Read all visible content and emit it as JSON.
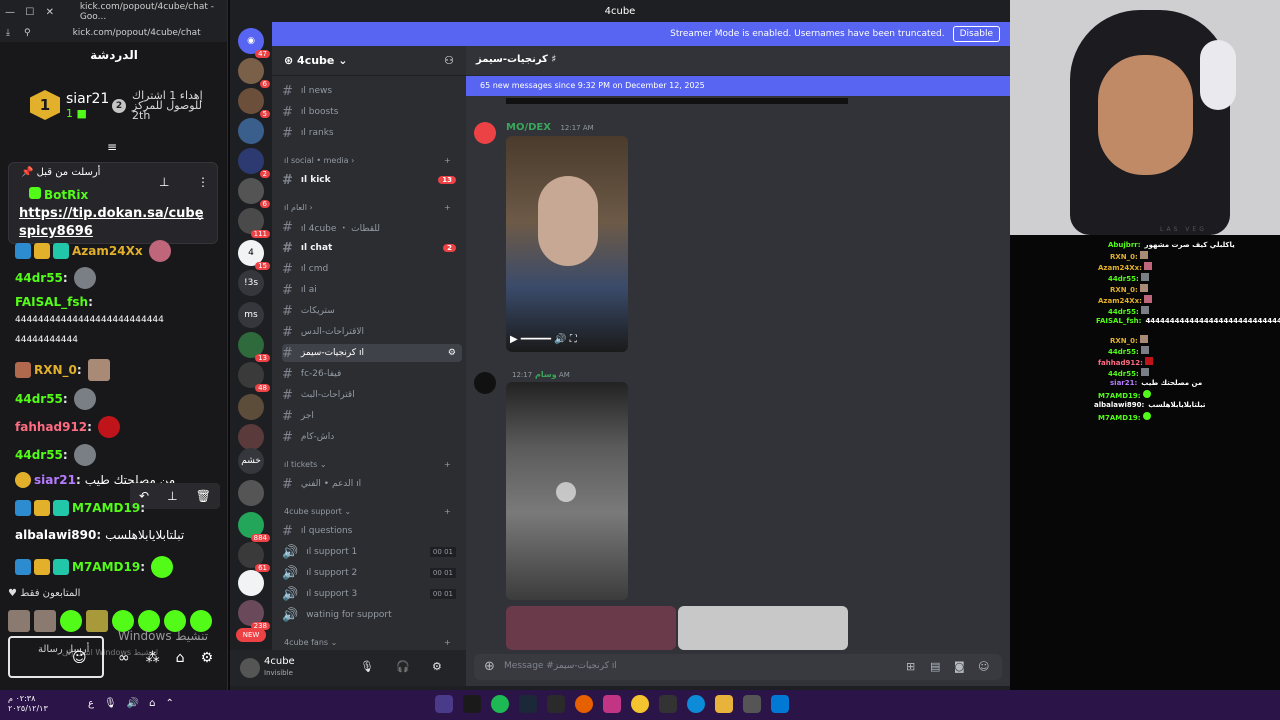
{
  "kick": {
    "window_title": "kick.com/popout/4cube/chat - Goo...",
    "url": "kick.com/popout/4cube/chat",
    "panel_title": "الدردشة",
    "leader": {
      "rank": "1",
      "name": "siar21",
      "count": "1"
    },
    "leader2": {
      "rank": "2",
      "text": "إهداء 1 اشتراك للوصول للمركز 2th"
    },
    "pinned": {
      "header": "أرسلت من قبل",
      "sender": "BotRix",
      "link": "https://tip.dokan.sa/cube spicy8696"
    },
    "messages": [
      {
        "user": "Azam24Xx",
        "text": "",
        "color": "#e2b02b"
      },
      {
        "user": "44dr55",
        "text": "",
        "color": "#53fc18"
      },
      {
        "user": "FAISAL_fsh",
        "text": "",
        "color": "#53fc18"
      },
      {
        "user": "",
        "text": "44444444444444444444444444",
        "color": "#ffffff"
      },
      {
        "user": "",
        "text": "44444444444",
        "color": "#ffffff"
      },
      {
        "user": "RXN_0",
        "text": "",
        "color": "#e2b02b"
      },
      {
        "user": "44dr55",
        "text": "",
        "color": "#53fc18"
      },
      {
        "user": "fahhad912",
        "text": "",
        "color": "#ff6b81"
      },
      {
        "user": "44dr55",
        "text": "",
        "color": "#53fc18"
      },
      {
        "user": "siar21",
        "text": "من مصلحتك طيب",
        "color": "#b57bff"
      },
      {
        "user": "M7AMD19",
        "text": "",
        "color": "#53fc18"
      },
      {
        "user": "albalawi890",
        "text": "تبلتابلايابلاهلسب",
        "color": "#ffffff"
      },
      {
        "user": "M7AMD19",
        "text": "",
        "color": "#53fc18"
      }
    ],
    "followers_label": "المتابعون فقط",
    "input_placeholder": "أرسل رسالة",
    "windows_activate": "Windows تنشيط",
    "windows_activate_sub": "انتقل إلى Windows لتنشيط"
  },
  "discord": {
    "title": "4cube",
    "streamer_banner": "Streamer Mode is enabled. Usernames have been truncated.",
    "disable_label": "Disable",
    "server_name": "4cube",
    "channel_header": "كرنجيات-سيمز ♯",
    "new_messages": "65 new messages since 9:32 PM on December 12, 2025",
    "guild_badges": [
      "47",
      "6",
      "5",
      "2",
      "6",
      "111",
      "15",
      "13",
      "48",
      "884",
      "61",
      "238"
    ],
    "guild_labels": [
      "!3s",
      "ms",
      "خشم",
      "NEW"
    ],
    "channels": [
      {
        "name": "ıl news",
        "type": "text"
      },
      {
        "name": "ıl boosts",
        "type": "text"
      },
      {
        "name": "ıl ranks",
        "type": "text"
      },
      {
        "name": "ıl social • media",
        "type": "category"
      },
      {
        "name": "ıl kick",
        "type": "text",
        "badge": "13"
      },
      {
        "name": "ıl العام",
        "type": "category"
      },
      {
        "name": "ıl 4cube ・ للقطات",
        "type": "text"
      },
      {
        "name": "ıl chat",
        "type": "text",
        "badge": "2"
      },
      {
        "name": "ıl cmd",
        "type": "text"
      },
      {
        "name": "ıl ai",
        "type": "text"
      },
      {
        "name": "ستريكات",
        "type": "text"
      },
      {
        "name": "الاقتراحات-الدس",
        "type": "text"
      },
      {
        "name": "كرنجيات-سيمز ıl",
        "type": "text",
        "active": true
      },
      {
        "name": "fc-26-فيفا",
        "type": "text"
      },
      {
        "name": "اقتراحات-البث",
        "type": "text"
      },
      {
        "name": "اجر",
        "type": "text"
      },
      {
        "name": "داش-كام",
        "type": "text"
      },
      {
        "name": "ıl tickets",
        "type": "category"
      },
      {
        "name": "الدعم • الفني ıl",
        "type": "text"
      },
      {
        "name": "4cube support",
        "type": "category"
      },
      {
        "name": "ıl questions",
        "type": "text"
      },
      {
        "name": "ıl support 1",
        "type": "voice",
        "counts": [
          "00",
          "01"
        ]
      },
      {
        "name": "ıl support 2",
        "type": "voice",
        "counts": [
          "00",
          "01"
        ]
      },
      {
        "name": "ıl support 3",
        "type": "voice",
        "counts": [
          "00",
          "01"
        ]
      },
      {
        "name": "watinig for support",
        "type": "voice"
      },
      {
        "name": "4cube fans",
        "type": "category"
      }
    ],
    "posts": [
      {
        "author": "MO/DEX",
        "time": "12:17 AM",
        "color": "#3ba55c"
      },
      {
        "author": "وسام",
        "time": "12:17 AM",
        "color": "#3ba55c"
      }
    ],
    "user": {
      "name": "4cube",
      "status": "Invisible"
    },
    "composer_placeholder": "Message #كرنجيات-سيمز ıl"
  },
  "overlay_chat": [
    {
      "user": "Abujbrr",
      "text": "ياكلبلي كيف صرت مشهور",
      "color": "#53fc18"
    },
    {
      "user": "RXN_0",
      "text": "",
      "color": "#e2b02b"
    },
    {
      "user": "Azam24Xx",
      "text": "",
      "color": "#e2b02b"
    },
    {
      "user": "44dr55",
      "text": "",
      "color": "#53fc18"
    },
    {
      "user": "RXN_0",
      "text": "",
      "color": "#e2b02b"
    },
    {
      "user": "Azam24Xx",
      "text": "",
      "color": "#e2b02b"
    },
    {
      "user": "44dr55",
      "text": "",
      "color": "#53fc18"
    },
    {
      "user": "FAISAL_fsh",
      "text": "44444444444444444444444444444",
      "color": "#53fc18"
    },
    {
      "user": "RXN_0",
      "text": "",
      "color": "#e2b02b"
    },
    {
      "user": "44dr55",
      "text": "",
      "color": "#53fc18"
    },
    {
      "user": "fahhad912",
      "text": "",
      "color": "#ff6b81"
    },
    {
      "user": "44dr55",
      "text": "",
      "color": "#53fc18"
    },
    {
      "user": "siar21",
      "text": "من مصلحتك طيب",
      "color": "#b57bff"
    },
    {
      "user": "M7AMD19",
      "text": "",
      "color": "#53fc18"
    },
    {
      "user": "albalawi890",
      "text": "تبلتابلايابلاهلسب",
      "color": "#ffffff"
    },
    {
      "user": "M7AMD19",
      "text": "",
      "color": "#53fc18"
    }
  ],
  "cam_text": "LAS VEG",
  "taskbar": {
    "time": "٠٢:٣٨ م",
    "date": "٢٠٢٥/١٢/١٣"
  }
}
